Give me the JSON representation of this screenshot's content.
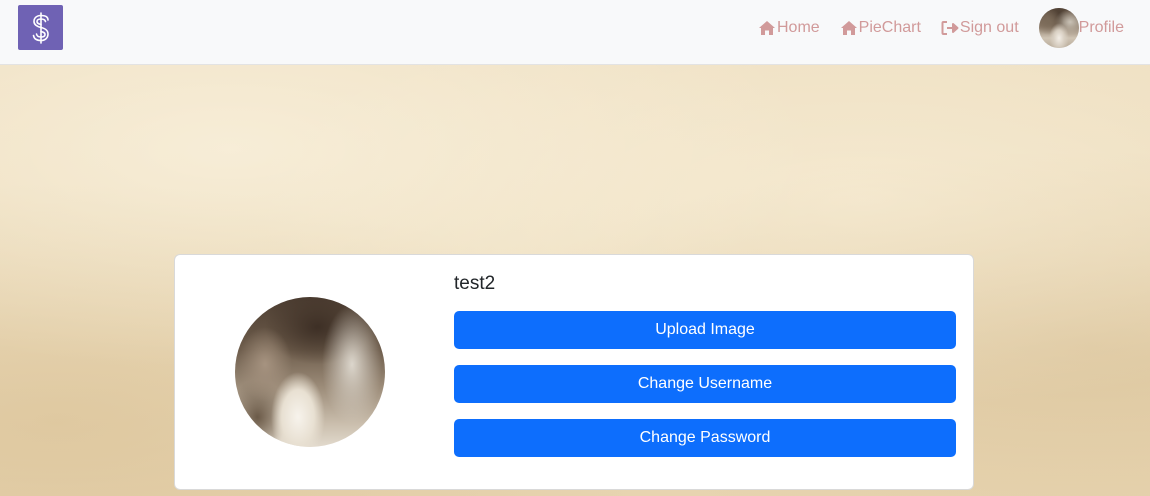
{
  "nav": {
    "brand_icon": "dollar-sign-icon",
    "links": [
      {
        "label": "Home",
        "icon": "home-icon"
      },
      {
        "label": "PieChart",
        "icon": "home-icon"
      },
      {
        "label": "Sign out",
        "icon": "sign-out-icon"
      },
      {
        "label": "Profile",
        "icon": "avatar"
      }
    ]
  },
  "profile": {
    "username": "test2",
    "buttons": {
      "upload": "Upload Image",
      "change_username": "Change Username",
      "change_password": "Change Password"
    }
  },
  "colors": {
    "brand": "#6f62b4",
    "nav_link": "#d19a9a",
    "primary_button": "#0d6efd"
  }
}
